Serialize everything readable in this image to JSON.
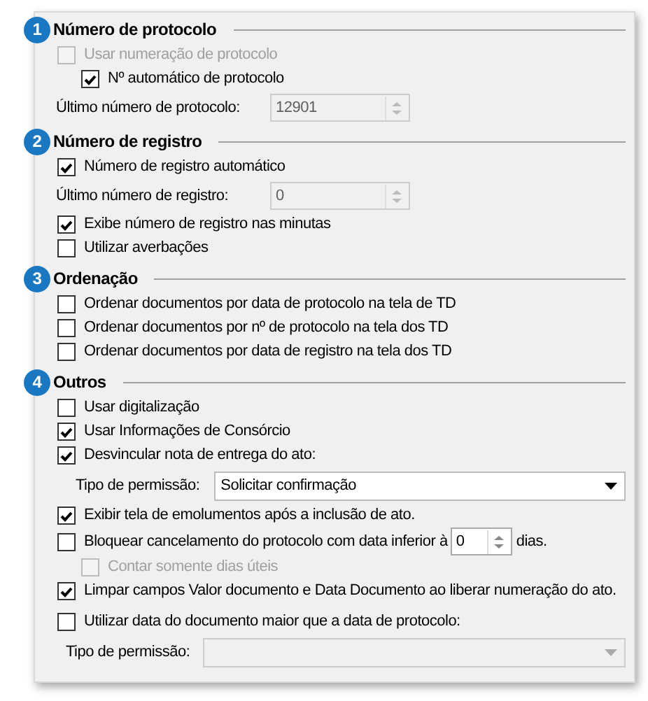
{
  "sections": [
    {
      "number": "1",
      "title": "Número de protocolo",
      "items": [
        {
          "kind": "checkbox",
          "label": "Usar numeração de protocolo",
          "checked": false,
          "disabled": true,
          "children": [
            {
              "kind": "checkbox",
              "label": "Nº automático de protocolo",
              "checked": true,
              "disabled": false
            }
          ]
        },
        {
          "kind": "number",
          "label": "Último número de protocolo:",
          "value": "12901",
          "disabled": true
        }
      ]
    },
    {
      "number": "2",
      "title": "Número de registro",
      "items": [
        {
          "kind": "checkbox",
          "label": "Número de registro automático",
          "checked": true,
          "disabled": false
        },
        {
          "kind": "number",
          "label": "Último número de registro:",
          "value": "0",
          "disabled": true
        },
        {
          "kind": "checkbox",
          "label": "Exibe número de registro nas minutas",
          "checked": true,
          "disabled": false
        },
        {
          "kind": "checkbox",
          "label": "Utilizar averbações",
          "checked": false,
          "disabled": false
        }
      ]
    },
    {
      "number": "3",
      "title": "Ordenação",
      "items": [
        {
          "kind": "checkbox",
          "label": "Ordenar documentos por data de protocolo na tela de TD",
          "checked": false,
          "disabled": false
        },
        {
          "kind": "checkbox",
          "label": "Ordenar documentos por nº de protocolo na tela dos TD",
          "checked": false,
          "disabled": false
        },
        {
          "kind": "checkbox",
          "label": "Ordenar documentos por data de registro na tela dos TD",
          "checked": false,
          "disabled": false
        }
      ]
    },
    {
      "number": "4",
      "title": "Outros",
      "items": [
        {
          "kind": "checkbox",
          "label": "Usar digitalização",
          "checked": false,
          "disabled": false
        },
        {
          "kind": "checkbox",
          "label": "Usar Informações de Consórcio",
          "checked": true,
          "disabled": false
        },
        {
          "kind": "checkbox",
          "label": "Desvincular nota de entrega do ato:",
          "checked": true,
          "disabled": false
        },
        {
          "kind": "select",
          "label": "Tipo de permissão:",
          "value": "Solicitar confirmação",
          "disabled": false
        },
        {
          "kind": "checkbox",
          "label": "Exibir tela de emolumentos após a inclusão de ato.",
          "checked": true,
          "disabled": false
        },
        {
          "kind": "checkbox-spin",
          "label": "Bloquear cancelamento do protocolo com data inferior à",
          "value": "0",
          "suffix": "dias.",
          "checked": false,
          "disabled": false,
          "children": [
            {
              "kind": "checkbox",
              "label": "Contar somente dias úteis",
              "checked": false,
              "disabled": true
            }
          ]
        },
        {
          "kind": "checkbox",
          "label": "Limpar campos Valor documento e Data Documento ao liberar numeração do ato.",
          "checked": true,
          "disabled": false
        },
        {
          "kind": "checkbox",
          "label": "Utilizar data do documento maior que a data de protocolo:",
          "checked": false,
          "disabled": false
        },
        {
          "kind": "select",
          "label": "Tipo de permissão:",
          "disabled": true
        }
      ]
    }
  ]
}
